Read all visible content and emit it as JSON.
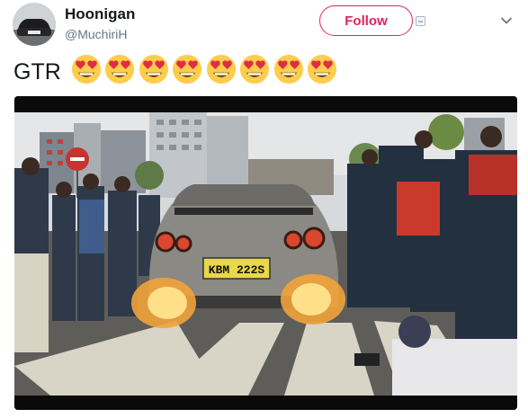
{
  "author": {
    "display_name": "Hoonigan",
    "handle": "@MuchiriH"
  },
  "follow_button": {
    "label": "Follow"
  },
  "tweet": {
    "text": "GTR",
    "emojis": [
      "heart-eyes-emoji",
      "heart-eyes-emoji",
      "heart-eyes-emoji",
      "heart-eyes-emoji",
      "heart-eyes-emoji",
      "heart-eyes-emoji",
      "heart-eyes-emoji",
      "heart-eyes-emoji"
    ]
  },
  "media": {
    "license_plate": "KBM 222S"
  },
  "colors": {
    "accent": "#e0245e",
    "name": "#14171a",
    "secondary": "#657786"
  },
  "icons": [
    "chevron-down-icon",
    "media-badge-icon"
  ]
}
